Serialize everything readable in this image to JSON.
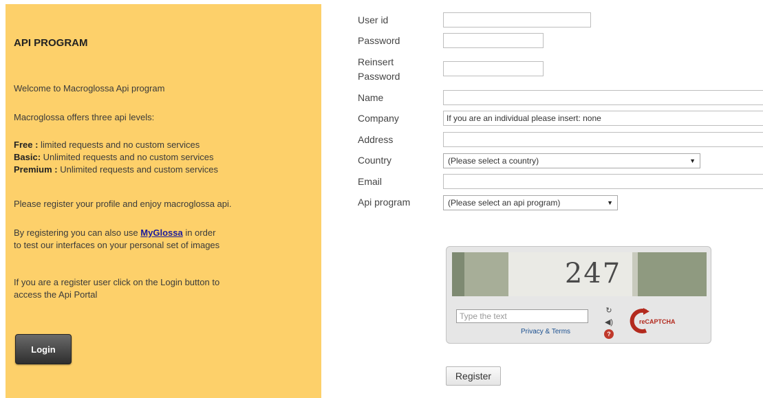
{
  "sidebar": {
    "title": "API PROGRAM",
    "welcome": "Welcome to Macroglossa Api program",
    "levels_intro": "Macroglossa offers three api levels:",
    "levels": [
      {
        "name": "Free :",
        "desc": "limited requests and no custom services"
      },
      {
        "name": "Basic:",
        "desc": "Unlimited requests and no custom services"
      },
      {
        "name": "Premium :",
        "desc": "Unlimited requests and custom services"
      }
    ],
    "register_text": "Please register your profile and enjoy macroglossa api.",
    "myglossa_pre": "By registering you can also use",
    "myglossa_link": "MyGlossa",
    "myglossa_post": "in order",
    "myglossa_line2": "to test our interfaces on your personal set of images",
    "login_line1": "If you are a register user click on the Login button to",
    "login_line2": "access the Api Portal",
    "login_button": "Login",
    "bg_color": "#fdd06a"
  },
  "form": {
    "labels": {
      "user_id": "User id",
      "password": "Password",
      "reinsert_1": "Reinsert",
      "reinsert_2": "Password",
      "name": "Name",
      "company": "Company",
      "address": "Address",
      "country": "Country",
      "email": "Email",
      "api_program": "Api program"
    },
    "values": {
      "user_id": "",
      "password": "",
      "reinsert_password": "",
      "name": "",
      "company": "If you are an individual please insert: none",
      "address": "",
      "email": ""
    },
    "country_selected": "(Please select a country)",
    "api_program_selected": "(Please select an api program)",
    "register_button": "Register"
  },
  "captcha": {
    "challenge_text": "247",
    "input_placeholder": "Type the text",
    "privacy_terms": "Privacy & Terms",
    "logo_text": "reCAPTCHA",
    "icons": [
      "refresh-icon",
      "audio-icon",
      "help-icon"
    ],
    "help_glyph": "?"
  }
}
